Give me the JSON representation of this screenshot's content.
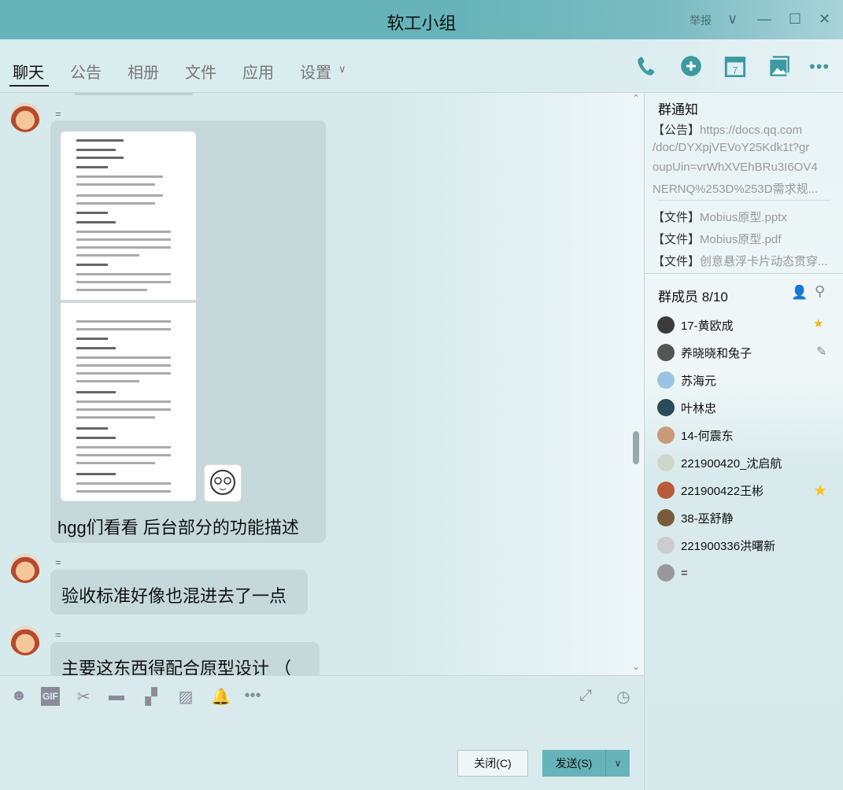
{
  "window": {
    "title": "软工小组",
    "report": "举报",
    "controls": {
      "collapse": "∨",
      "minimize": "—",
      "maximize": "☐",
      "close": "✕"
    }
  },
  "tabs": [
    {
      "label": "聊天"
    },
    {
      "label": "公告"
    },
    {
      "label": "相册"
    },
    {
      "label": "文件"
    },
    {
      "label": "应用"
    },
    {
      "label": "设置"
    }
  ],
  "tab_settings_chevron": "∨",
  "messages": [
    {
      "sender": "=",
      "text": "hgg们看看  后台部分的功能描述"
    },
    {
      "sender": "=",
      "text": "验收标准好像也混进去了一点"
    },
    {
      "sender": "=",
      "text": "主要这东西得配合原型设计 （"
    }
  ],
  "group_notice": {
    "title": "群通知",
    "announcement_label": "【公告】",
    "announcement_text": [
      "https://docs.qq.com",
      "/doc/DYXpjVEVoY25Kdk1t?gr",
      "oupUin=vrWhXVEhBRu3I6OV4",
      "NERNQ%253D%253D需求规..."
    ],
    "files": [
      {
        "label": "【文件】",
        "name": "Mobius原型.pptx"
      },
      {
        "label": "【文件】",
        "name": "Mobius原型.pdf"
      },
      {
        "label": "【文件】",
        "name": "创意悬浮卡片动态贯穿..."
      }
    ]
  },
  "members": {
    "title": "群成员 8/10",
    "list": [
      {
        "name": "17-黄欧成",
        "badge": "owner"
      },
      {
        "name": "养晓晓和兔子",
        "badge": "edit"
      },
      {
        "name": "苏海元"
      },
      {
        "name": "叶林忠"
      },
      {
        "name": "14-何震东"
      },
      {
        "name": "221900420_沈启航"
      },
      {
        "name": "221900422王彬",
        "badge": "star"
      },
      {
        "name": "38-巫舒静"
      },
      {
        "name": "221900336洪曙新"
      },
      {
        "name": "="
      }
    ]
  },
  "input": {
    "close_label": "关闭(C)",
    "send_label": "发送(S)",
    "send_dropdown": "∨"
  },
  "colors": {
    "accent": "#66b4b9",
    "bubble": "#c5d8da",
    "icon": "#3d9aa0"
  }
}
